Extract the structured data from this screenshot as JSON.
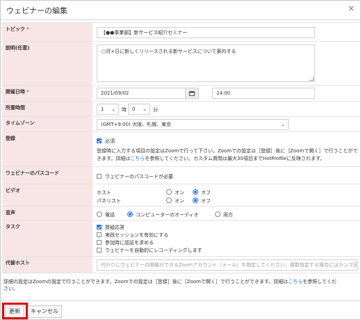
{
  "dialog": {
    "title": "ウェビナーの編集",
    "close": "×"
  },
  "topic": {
    "label": "トピック",
    "required_mark": "*",
    "value": "【●●事業部】新サービス紹介セミナー"
  },
  "description": {
    "label": "説明(任意)",
    "value": "○月×日に新しくリリースされる新サービスについて案内する"
  },
  "datetime": {
    "label": "開催日時",
    "required_mark": "*",
    "date": "2021/09/02",
    "calendar_icon": "calendar-icon",
    "time": "14:00"
  },
  "duration": {
    "label": "所要時間",
    "hours": "1",
    "hours_unit": "時",
    "minutes": "0",
    "minutes_unit": "分"
  },
  "timezone": {
    "label": "タイムゾーン",
    "value": "(GMT+9:00) 大阪、札幌、東京"
  },
  "registration": {
    "label": "登録",
    "required_label": "必須",
    "required_checked": true,
    "note_line1": "登録時に入力する項目の設定はZoomで行って下さい。Zoomでの設定は［登録］後に［Zoomで開く］で行うことがで",
    "note_line2_a": "きます。詳細は",
    "note_link": "こちら",
    "note_line2_b": "を参照してください。カスタム質問は最大30項目までHotProfileに反映されます。"
  },
  "passcode": {
    "label": "ウェビナーのパスコード",
    "option": "ウェビナーのパスコードが必要",
    "checked": false
  },
  "video": {
    "label": "ビデオ",
    "host_label": "ホスト",
    "panelist_label": "パネリスト",
    "on": "オン",
    "off": "オフ",
    "host_value": "オフ",
    "panelist_value": "オフ"
  },
  "audio": {
    "label": "音声",
    "options": [
      "電話",
      "コンピューターのオーディオ",
      "両方"
    ],
    "selected": "コンピューターのオーディオ"
  },
  "tasks": {
    "label": "タスク",
    "items": [
      {
        "label": "質疑応答",
        "checked": true
      },
      {
        "label": "実践セッションを有効にする",
        "checked": false
      },
      {
        "label": "参加時に認証を求める",
        "checked": false
      },
      {
        "label": "ウェビナーを自動的にレコーディングします",
        "checked": false
      }
    ]
  },
  "alt_host": {
    "label": "代替ホスト",
    "placeholder": "代わりにウェビナーの開催ができるZoomアカウント（メール）を指定してください。複数指定する場合にはカンマ区切り"
  },
  "footer": {
    "note_a": "詳細の設定はZoomの設定で行うことができます。Zoomでの設定は［登録］後に［Zoomで開く］で行うことができます。詳細は",
    "note_link": "こちら",
    "note_b": "を参照してくだ",
    "note_line2": "さい。",
    "update_label": "更新",
    "cancel_label": "キャンセル"
  },
  "colors": {
    "label_bg": "#f8e5e6",
    "accent": "#2d76e0",
    "highlight": "#e00000"
  }
}
